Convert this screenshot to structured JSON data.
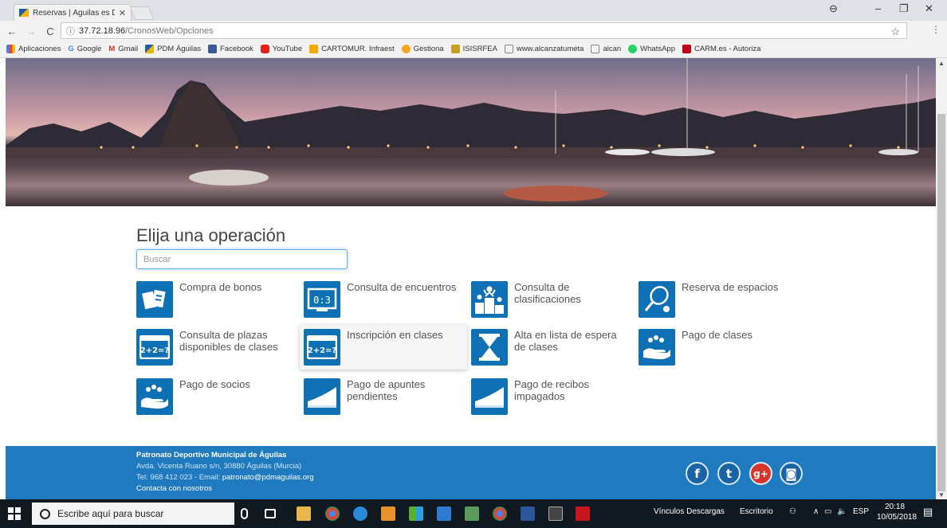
{
  "browser": {
    "tab_title": "Reservas | Águilas es Dep",
    "url_host": "37.72.18.96",
    "url_path": "/CronosWeb/Opciones",
    "bookmarks": [
      "Aplicaciones",
      "Google",
      "Gmail",
      "PDM Águilas",
      "Facebook",
      "YouTube",
      "CARTOMUR. Infraest",
      "Gestiona",
      "ISISRFEA",
      "www.alcanzatumeta",
      "alcan",
      "WhatsApp",
      "CARM.es - Autoriza"
    ]
  },
  "page": {
    "heading": "Elija una operación",
    "search_placeholder": "Buscar",
    "operations": [
      {
        "label": "Compra de bonos",
        "icon": "tickets-icon"
      },
      {
        "label": "Consulta de encuentros",
        "icon": "scoreboard-icon"
      },
      {
        "label": "Consulta de clasificaciones",
        "icon": "podium-icon"
      },
      {
        "label": "Reserva de espacios",
        "icon": "tennis-racket-icon"
      },
      {
        "label": "Consulta de plazas disponibles de clases",
        "icon": "blackboard-icon"
      },
      {
        "label": "Inscripción en clases",
        "icon": "blackboard-icon"
      },
      {
        "label": "Alta en lista de espera de clases",
        "icon": "hourglass-icon"
      },
      {
        "label": "Pago de clases",
        "icon": "coins-hand-icon"
      },
      {
        "label": "Pago de socios",
        "icon": "coins-hand-icon"
      },
      {
        "label": "Pago de apuntes pendientes",
        "icon": "ramp-icon"
      },
      {
        "label": "Pago de recibos impagados",
        "icon": "ramp-icon"
      }
    ],
    "blackboard_text": "2+2=?"
  },
  "footer": {
    "title": "Patronato Deportivo Municipal de Águilas",
    "address": "Avda. Vicenta Ruano s/n, 30880 Águilas (Murcia)",
    "contact_prefix": "Tel: 968 412 023 - Email: ",
    "email": "patronato@pdmaguilas.org",
    "contact_link": "Contacta con nosotros",
    "social": [
      "facebook-icon",
      "twitter-icon",
      "google-plus-icon",
      "instagram-icon"
    ]
  },
  "taskbar": {
    "search_placeholder": "Escribe aquí para buscar",
    "tray_links": "Vínculos  Descargas",
    "tray_desktop": "Escritorio",
    "language": "ESP",
    "time": "20:18",
    "date": "10/05/2018"
  },
  "colors": {
    "accent": "#0f71b5",
    "footer": "#1f7ac0"
  }
}
